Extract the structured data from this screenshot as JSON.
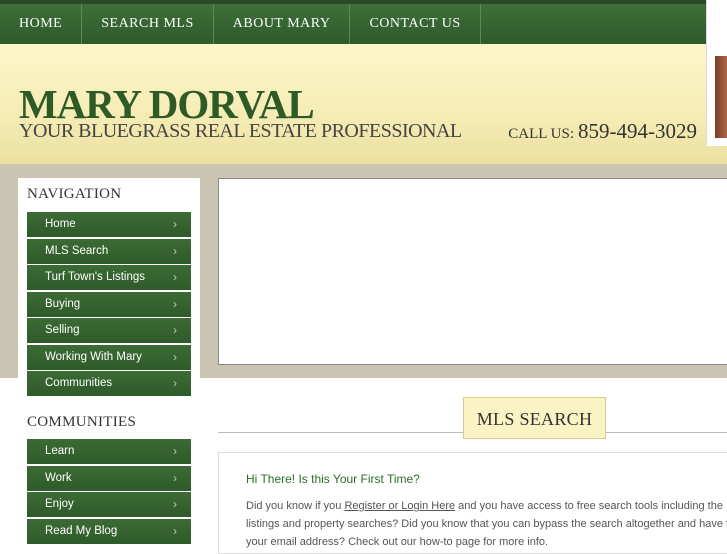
{
  "topnav": {
    "items": [
      "HOME",
      "SEARCH MLS",
      "ABOUT MARY",
      "CONTACT US"
    ]
  },
  "header": {
    "name": "MARY DORVAL",
    "tagline": "YOUR BLUEGRASS REAL ESTATE PROFESSIONAL",
    "call_label": "CALL US:",
    "phone": "859-494-3029"
  },
  "sidebar": {
    "navigation_title": "NAVIGATION",
    "navigation_items": [
      "Home",
      "MLS Search",
      "Turf Town's Listings",
      "Buying",
      "Selling",
      "Working With Mary",
      "Communities"
    ],
    "communities_title": "COMMUNITIES",
    "communities_items": [
      "Learn",
      "Work",
      "Enjoy",
      "Read My Blog"
    ]
  },
  "main": {
    "section_title": "MLS SEARCH",
    "heading": "Hi There! Is this Your First Time?",
    "para_1": "Did you know if you ",
    "link": "Register or Login Here",
    "para_2": " and you have access to free search tools including the listings and property searches? Did you know that you can bypass the search altogether and have to your email address? Check out our how-to page for more info."
  },
  "colors": {
    "green": "#2e5a25",
    "cream": "#fdf6c9",
    "band": "#cac4b3"
  }
}
